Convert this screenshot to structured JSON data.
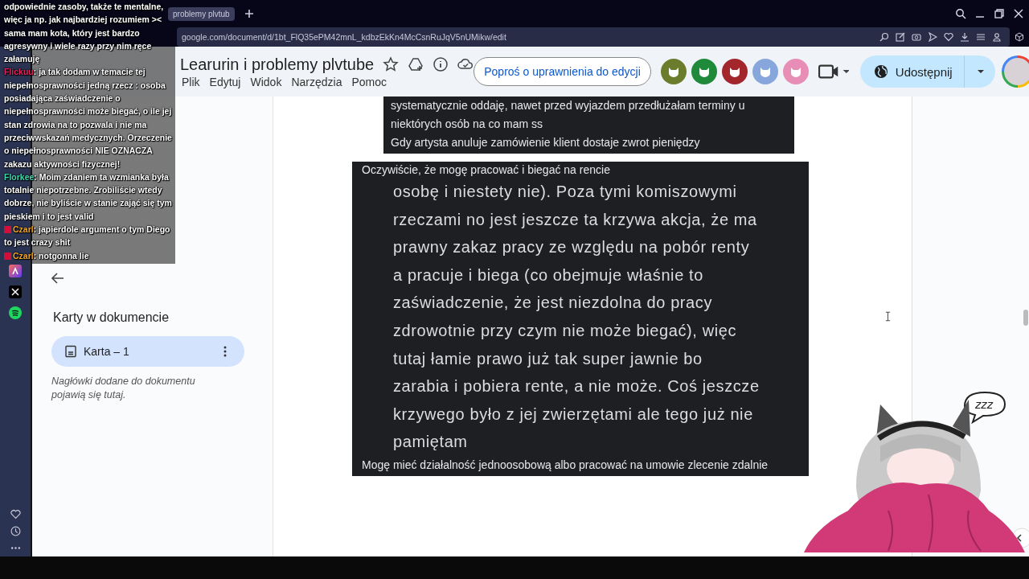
{
  "browser": {
    "tab_title": "problemy plvtub",
    "url": "google.com/document/d/1bt_FlQ35ePM42mnL_kdbzEkKn4McCsnRuJqV5nUMikw/edit"
  },
  "document": {
    "title": "Learurin i problemy plvtube",
    "menu": [
      "Plik",
      "Edytuj",
      "Widok",
      "Narzędzia",
      "Pomoc"
    ],
    "request_button": "Poproś o uprawnienia do edycji",
    "collaborators": [
      {
        "color": "#6b7d2c"
      },
      {
        "color": "#1e8a3a"
      },
      {
        "color": "#a3262c"
      },
      {
        "color": "#87a6dc"
      },
      {
        "color": "#e88db5"
      }
    ],
    "share_button": "Udostępnij"
  },
  "tabs_pane": {
    "heading": "Karty w dokumencie",
    "tabs": [
      {
        "label": "Karta – 1",
        "selected": true
      }
    ],
    "hint": "Nagłówki dodane do dokumentu pojawią się tutaj."
  },
  "page": {
    "images": [
      {
        "lines": [
          {
            "kind": "small",
            "text": "systematycznie oddaję, nawet przed wyjazdem przedłużałam terminy u"
          },
          {
            "kind": "small",
            "text": "niektórych osób na co mam ss"
          },
          {
            "kind": "small",
            "text": "Gdy artysta anuluje zamówienie klient dostaje zwrot pieniędzy"
          }
        ]
      },
      {
        "lines": [
          {
            "kind": "small",
            "text": "Oczywiście, że mogę pracować i biegać na rencie"
          },
          {
            "kind": "large",
            "text": "osobę i niestety nie). Poza tymi komiszowymi"
          },
          {
            "kind": "large",
            "text": "rzeczami no jest jeszcze ta krzywa akcja, że ma"
          },
          {
            "kind": "large",
            "text": "prawny zakaz pracy ze względu na pobór renty"
          },
          {
            "kind": "large",
            "text": "a pracuje i biega (co obejmuje właśnie to"
          },
          {
            "kind": "large",
            "text": "zaświadczenie, że jest niezdolna do pracy"
          },
          {
            "kind": "large",
            "text": "zdrowotnie przy czym nie może biegać), więc"
          },
          {
            "kind": "large",
            "text": "tutaj łamie prawo już tak super jawnie bo"
          },
          {
            "kind": "large",
            "text": "zarabia i pobiera rente, a nie może. Coś jeszcze"
          },
          {
            "kind": "large",
            "text": "krzywego było z jej zwierzętami ale tego już nie"
          },
          {
            "kind": "large",
            "text": "pamiętam"
          },
          {
            "kind": "small",
            "text": "Mogę mieć działalność jednoosobową albo pracować na umowie zlecenie zdalnie"
          }
        ]
      }
    ]
  },
  "chat": [
    {
      "badge": false,
      "text": "odpowiednie zasoby, także te mentalne, więc ja np. jak najbardziej rozumiem >< sama mam kota, który jest bardzo agresywny i wiele razy przy nim ręce załamuję"
    },
    {
      "user": "Flickuu",
      "color": "#e0245e",
      "badge": false,
      "text": ": ja tak dodam w temacie tej niepełnosprawności jedną rzecz : osoba posiadająca zaświadczenie o niepełnosprawności może biegać, o ile jej stan zdrowia na to pozwala i nie ma przeciwwskazań medycznych. Orzeczenie o niepełnosprawności NIE OZNACZA zakazu aktywności fizycznej!"
    },
    {
      "user": "Florkee",
      "color": "#3ddbb0",
      "badge": false,
      "text": ": Moim zdaniem ta wzmianka była totalnie niepotrzebne. Zrobiliście wtedy dobrze, nie byliście w stanie zająć się tym pieskiem i to jest valid"
    },
    {
      "user": "Czarl",
      "color": "#f5a623",
      "badge": true,
      "text": ": japierdole argument o tym Diego to jest crazy shit"
    },
    {
      "user": "Czarl",
      "color": "#f5a623",
      "badge": true,
      "text": ": notgonna lie"
    }
  ],
  "mascot": {
    "bubble_text": "zzz"
  }
}
